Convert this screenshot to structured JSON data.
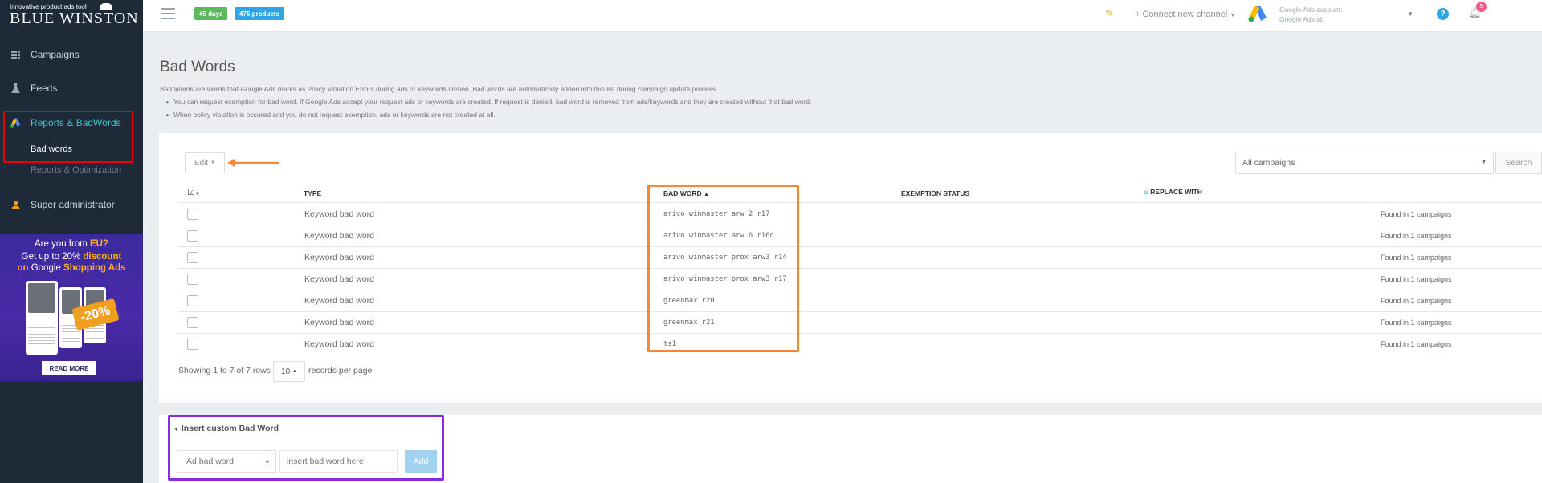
{
  "sidebar": {
    "logo_tag": "Innovative product ads tool",
    "logo_brand": "BLUE WINSTON",
    "nav": [
      {
        "label": "Campaigns",
        "icon": "grid-icon"
      },
      {
        "label": "Feeds",
        "icon": "flask-icon"
      },
      {
        "label": "Reports & BadWords",
        "icon": "google-ads-icon"
      },
      {
        "label": "Super administrator",
        "icon": "user-icon"
      }
    ],
    "sub_items": [
      "Bad words",
      "Reports & Optimization"
    ],
    "promo": {
      "line1a": "Are you from ",
      "line1b": "EU?",
      "line2a": "Get up to 20% ",
      "line2b": "discount",
      "line3a": "on ",
      "line3b": "Google ",
      "line3c": "Shopping Ads",
      "discount": "-20%",
      "button": "READ MORE"
    }
  },
  "topbar": {
    "days_badge": "45 days",
    "products_badge": "475 products",
    "connect": "+ Connect new channel",
    "account_label": "Google Ads account:",
    "account_id": "Google Ads id:",
    "notifications": "5"
  },
  "page": {
    "title": "Bad Words",
    "description": "Bad Words are words that Google Ads marks as Policy Violation Errors during ads or keywords cretion. Bad words are automatically added into this list during campaign update process.",
    "bullets": [
      "You can request exemption for bad word. If Google Ads accept your request ads or keywords are created. If request is denied, bad word is removed from ads/keywords and they are created without that bad word.",
      "When policy violation is occured and you do not request exemption, ads or keywords are not created at all."
    ]
  },
  "toolbar": {
    "edit": "Edit",
    "campaign_select": "All campaigns",
    "search": "Search"
  },
  "table": {
    "headers": {
      "type": "TYPE",
      "bad_word": "BAD WORD",
      "exemption": "EXEMPTION STATUS",
      "replace": "REPLACE WITH"
    },
    "rows": [
      {
        "type": "Keyword bad word",
        "word": "arivo winmaster arw 2 r17",
        "found": "Found in 1 campaigns"
      },
      {
        "type": "Keyword bad word",
        "word": "arivo winmaster arw 6 r16c",
        "found": "Found in 1 campaigns"
      },
      {
        "type": "Keyword bad word",
        "word": "arivo winmaster prox arw3 r14",
        "found": "Found in 1 campaigns"
      },
      {
        "type": "Keyword bad word",
        "word": "arivo winmaster prox arw3 r17",
        "found": "Found in 1 campaigns"
      },
      {
        "type": "Keyword bad word",
        "word": "greenmax r20",
        "found": "Found in 1 campaigns"
      },
      {
        "type": "Keyword bad word",
        "word": "greenmax r21",
        "found": "Found in 1 campaigns"
      },
      {
        "type": "Keyword bad word",
        "word": "ts1",
        "found": "Found in 1 campaigns"
      }
    ]
  },
  "pagination": {
    "showing": "Showing 1 to 7 of 7 rows",
    "per_page": "10",
    "records_label": "records per page"
  },
  "insert": {
    "heading": "Insert custom Bad Word",
    "select_value": "Ad bad word",
    "input_placeholder": "insert bad word here",
    "add": "Add"
  },
  "colors": {
    "sidebar_bg": "#1e2a38",
    "active_accent": "#3fc1c9",
    "highlight_red": "#e00000",
    "highlight_orange": "#f4893a",
    "highlight_purple": "#8a2be2"
  }
}
